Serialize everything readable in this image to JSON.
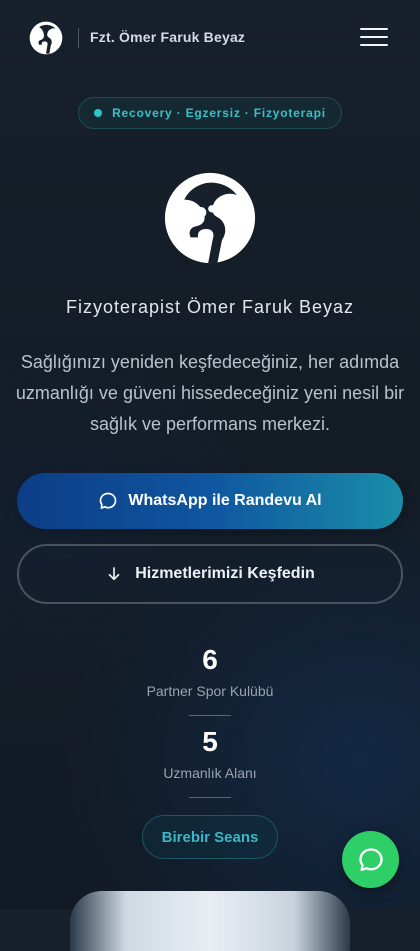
{
  "header": {
    "brand": "Fzt. Ömer Faruk Beyaz",
    "logo_icon": "knee-joint-logo-icon",
    "menu_icon": "hamburger-menu-icon"
  },
  "hero": {
    "tagline": "Recovery · Egzersiz · Fizyoterapi",
    "title": "Fizyoterapist Ömer Faruk Beyaz",
    "description": "Sağlığınızı yeniden keşfedeceğiniz, her adımda uzmanlığı ve güveni hissedeceğiniz yeni nesil bir sağlık ve performans merkezi."
  },
  "buttons": {
    "whatsapp": "WhatsApp ile Randevu Al",
    "services": "Hizmetlerimizi Keşfedin"
  },
  "stats": [
    {
      "value": "6",
      "label": "Partner Spor Kulübü"
    },
    {
      "value": "5",
      "label": "Uzmanlık Alanı"
    }
  ],
  "badge": "Birebir Seans",
  "colors": {
    "accent_teal": "#39c1c9",
    "whatsapp_green": "#2fcf68",
    "button_blue": "#0f56a0"
  }
}
